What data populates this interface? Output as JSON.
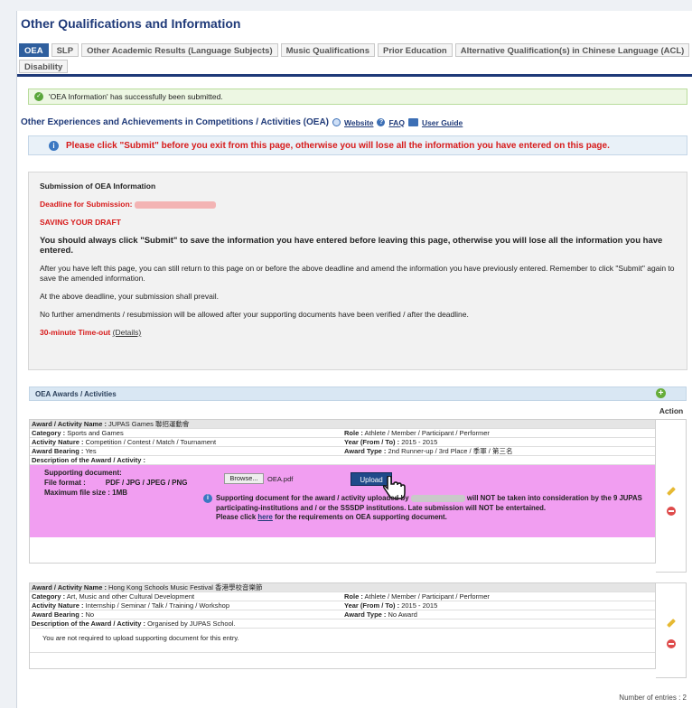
{
  "page_title": "Other Qualifications and Information",
  "tabs": [
    {
      "label": "OEA",
      "active": true
    },
    {
      "label": "SLP",
      "active": false
    },
    {
      "label": "Other Academic Results (Language Subjects)",
      "active": false
    },
    {
      "label": "Music Qualifications",
      "active": false
    },
    {
      "label": "Prior Education",
      "active": false
    },
    {
      "label": "Alternative Qualification(s) in Chinese Language (ACL)",
      "active": false
    },
    {
      "label": "Disability",
      "active": false
    }
  ],
  "success_message": "'OEA Information' has successfully been submitted.",
  "section": {
    "title": "Other Experiences and Achievements in Competitions / Activities (OEA)",
    "links": {
      "website": "Website",
      "faq": "FAQ",
      "guide": "User Guide"
    }
  },
  "warning": "Please click \"Submit\" before you exit from this page, otherwise you will lose all the information you have entered on this page.",
  "submission": {
    "title": "Submission of OEA Information",
    "deadline_label": "Deadline for Submission:",
    "saving_label": "SAVING YOUR DRAFT",
    "p1": "You should always click \"Submit\" to save the information you have entered before leaving this page, otherwise you will lose all the information you have entered.",
    "p2": "After you have left this page, you can still return to this page on or before the above deadline and amend the information you have previously entered. Remember to click \"Submit\" again to save the amended information.",
    "p3": "At the above deadline, your submission shall prevail.",
    "p4": "No further amendments / resubmission will be allowed after your supporting documents have been verified / after the deadline.",
    "timeout_label": "30-minute Time-out",
    "details_link": "(Details)"
  },
  "awards": {
    "bar_title": "OEA Awards / Activities",
    "action_header": "Action",
    "labels": {
      "name": "Award / Activity Name :",
      "category": "Category :",
      "role": "Role :",
      "nature": "Activity Nature :",
      "year": "Year (From / To) :",
      "bearing": "Award Bearing :",
      "type": "Award Type :",
      "description": "Description of the Award / Activity :"
    },
    "entries": [
      {
        "name": "JUPAS Games 聯招運動會",
        "category": "Sports and Games",
        "role": "Athlete / Member / Participant / Performer",
        "nature": "Competition / Contest / Match / Tournament",
        "year": "2015 - 2015",
        "bearing": "Yes",
        "type": "2nd Runner-up / 3rd Place / 季軍 / 第三名",
        "description": ""
      },
      {
        "name": "Hong Kong Schools Music Festival 香港學校音樂節",
        "category": "Art, Music and other Cultural Development",
        "role": "Athlete / Member / Participant / Performer",
        "nature": "Internship / Seminar / Talk / Training / Workshop",
        "year": "2015 - 2015",
        "bearing": "No",
        "type": "No Award",
        "description": "Organised by JUPAS School.",
        "no_upload_note": "You are not required to upload supporting document for this entry."
      }
    ],
    "upload": {
      "doc_label": "Supporting document:",
      "format_label": "File format :",
      "format_value": "PDF / JPG / JPEG / PNG",
      "size_label": "Maximum file size :",
      "size_value": "1MB",
      "browse_label": "Browse...",
      "filename": "OEA.pdf",
      "upload_label": "Upload",
      "note_a": "Supporting document for the award / activity uploaded by",
      "note_b": "will NOT be taken into consideration by the 9 JUPAS participating-institutions and / or the SSSDP institutions. Late submission will NOT be entertained.",
      "note_c_pre": "Please click",
      "note_c_link": "here",
      "note_c_post": "for the requirements on OEA supporting document."
    },
    "entries_count": "Number of entries : 2"
  }
}
